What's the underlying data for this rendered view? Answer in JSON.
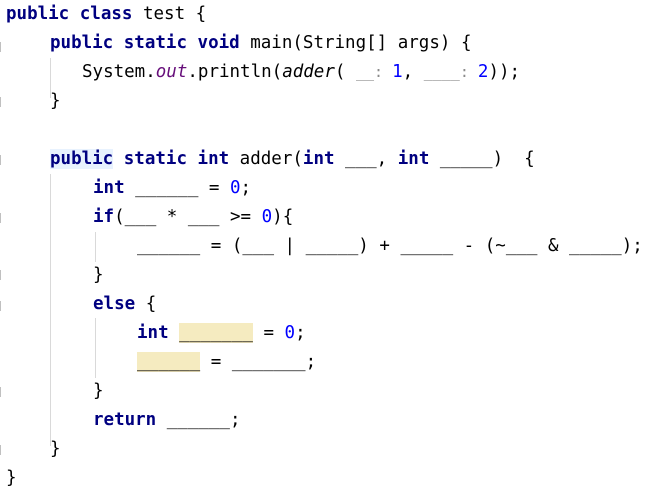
{
  "code": {
    "l1": {
      "kw_public": "public",
      "kw_class": "class",
      "rest": " test {"
    },
    "l2": {
      "kw_public": "public",
      "kw_static": "static",
      "kw_void": "void",
      "rest": " main(String[] args) {"
    },
    "l3": {
      "pre": "System.",
      "field": "out",
      "mid": ".println(",
      "method": "adder",
      "open": "( ",
      "blank1": "__",
      "hint1": ": ",
      "num1": "1",
      "comma": ", ",
      "blank2": "____",
      "hint2": ": ",
      "num2": "2",
      "close": "));"
    },
    "l4": {
      "text": "}"
    },
    "l5": {
      "kw_public": "public",
      "kw_static": "static",
      "kw_int": "int",
      "mid": " adder(",
      "kw_int2": "int",
      "blank1": " ___",
      "comma": ", ",
      "kw_int3": "int",
      "blank2": " _____",
      "close": ")  {"
    },
    "l6": {
      "kw_int": "int",
      "blank": " ______",
      "assign": " = ",
      "num": "0",
      "semi": ";"
    },
    "l7": {
      "kw_if": "if",
      "open": "(",
      "blank1": "___",
      "op": " * ",
      "blank2": "___",
      "cmp": " >= ",
      "num": "0",
      "close": "){"
    },
    "l8": {
      "blank1": "______",
      "eq": " = (",
      "blank2": "___",
      "pipe": " | ",
      "blank3": "_____",
      "plus": ") + ",
      "blank4": "_____",
      "minus": " - (~",
      "blank5": "___",
      "amp": " & ",
      "blank6": "_____",
      "end": ");"
    },
    "l9": {
      "text": "}"
    },
    "l10": {
      "kw_else": "else",
      "rest": " {"
    },
    "l11": {
      "kw_int": "int",
      "blank": "_______",
      "assign": " = ",
      "num": "0",
      "semi": ";"
    },
    "l12": {
      "blank1": "______",
      "eq": " = ",
      "blank2": "_______",
      "semi": ";"
    },
    "l13": {
      "text": "}"
    },
    "l14": {
      "kw_return": "return",
      "blank": " ______",
      "semi": ";"
    },
    "l15": {
      "text": "}"
    },
    "l16": {
      "text": "}"
    }
  },
  "colors": {
    "keyword": "#000080",
    "number": "#0000ff",
    "static_field": "#660e7a",
    "hint": "#8a8a8a",
    "highlight": "#f5ebc0",
    "indent_guide": "#d9d9d9"
  }
}
